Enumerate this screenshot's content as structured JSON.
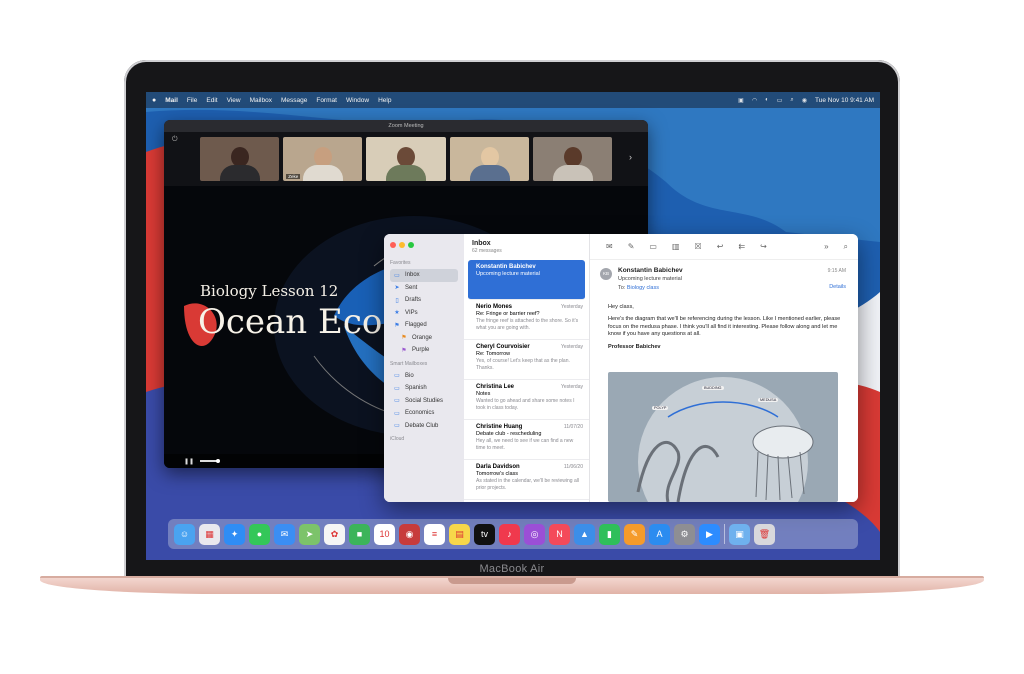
{
  "device": {
    "brand_label": "MacBook Air"
  },
  "menubar": {
    "app": "Mail",
    "items": [
      "File",
      "Edit",
      "View",
      "Mailbox",
      "Message",
      "Format",
      "Window",
      "Help"
    ],
    "clock": "Tue Nov 10  9:41 AM"
  },
  "zoom": {
    "window_title": "Zoom Meeting",
    "participant_tag": "Zeke",
    "slide_subtitle": "Biology Lesson 12",
    "slide_title": "Ocean Eco"
  },
  "mail": {
    "sidebar": {
      "favorites_header": "Favorites",
      "smart_header": "Smart Mailboxes",
      "icloud_header": "iCloud",
      "favorites": [
        {
          "label": "Inbox",
          "icon": "inbox-icon"
        },
        {
          "label": "Sent",
          "icon": "sent-icon"
        },
        {
          "label": "Drafts",
          "icon": "drafts-icon"
        },
        {
          "label": "VIPs",
          "icon": "star-icon"
        },
        {
          "label": "Flagged",
          "icon": "flag-icon"
        }
      ],
      "flag_subs": [
        "Orange",
        "Purple"
      ],
      "folders": [
        "Bio",
        "Spanish",
        "Social Studies",
        "Economics",
        "Debate Club"
      ]
    },
    "list": {
      "title": "Inbox",
      "count": "62 messages",
      "messages": [
        {
          "from": "Konstantin Babichev",
          "date": "",
          "subject": "Upcoming lecture material",
          "preview": ""
        },
        {
          "from": "Nerio Mones",
          "date": "Yesterday",
          "subject": "Re: Fringe or barrier reef?",
          "preview": "The fringe reef is attached to the shore. So it's what you are going with."
        },
        {
          "from": "Cheryl Courvoisier",
          "date": "Yesterday",
          "subject": "Re: Tomorrow",
          "preview": "Yes, of course! Let's keep that as the plan. Thanks."
        },
        {
          "from": "Christina Lee",
          "date": "Yesterday",
          "subject": "Notes",
          "preview": "Wanted to go ahead and share some notes I took in class today."
        },
        {
          "from": "Christine Huang",
          "date": "11/07/20",
          "subject": "Debate club - rescheduling",
          "preview": "Hey all, we need to see if we can find a new time to meet."
        },
        {
          "from": "Darla Davidson",
          "date": "11/06/20",
          "subject": "Tomorrow's class",
          "preview": "As stated in the calendar, we'll be reviewing all prior projects."
        }
      ]
    },
    "reader": {
      "avatar_initials": "KB",
      "from": "Konstantin Babichev",
      "subject": "Upcoming lecture material",
      "to_label": "To:",
      "to": "Biology class",
      "time": "9:15 AM",
      "details_label": "Details",
      "greeting": "Hey class,",
      "body": "Here's the diagram that we'll be referencing during the lesson. Like I mentioned earlier, please focus on the medusa phase. I think you'll all find it interesting. Please follow along and let me know if you have any questions at all.",
      "signature": "Professor Babichev",
      "diagram_labels": [
        "BUDDING",
        "POLYP",
        "MEDUSA"
      ]
    }
  },
  "dock": {
    "apps": [
      {
        "name": "finder",
        "color": "#4aa3f0",
        "glyph": "☺"
      },
      {
        "name": "launchpad",
        "color": "#e9e9ee",
        "glyph": "▦"
      },
      {
        "name": "safari",
        "color": "#2f8df5",
        "glyph": "✦"
      },
      {
        "name": "messages",
        "color": "#34c759",
        "glyph": "●"
      },
      {
        "name": "mail",
        "color": "#3b8ef3",
        "glyph": "✉"
      },
      {
        "name": "maps",
        "color": "#7cc36a",
        "glyph": "➤"
      },
      {
        "name": "photos",
        "color": "#f5f5f5",
        "glyph": "✿"
      },
      {
        "name": "facetime",
        "color": "#3cb45a",
        "glyph": "■"
      },
      {
        "name": "calendar",
        "color": "#ffffff",
        "glyph": "10"
      },
      {
        "name": "photo-booth",
        "color": "#c73b3b",
        "glyph": "◉"
      },
      {
        "name": "reminders",
        "color": "#ffffff",
        "glyph": "≡"
      },
      {
        "name": "notes",
        "color": "#f7d74a",
        "glyph": "▤"
      },
      {
        "name": "apple-tv",
        "color": "#111111",
        "glyph": "tv"
      },
      {
        "name": "music",
        "color": "#f0394d",
        "glyph": "♪"
      },
      {
        "name": "podcasts",
        "color": "#9b4fd6",
        "glyph": "◎"
      },
      {
        "name": "news",
        "color": "#f44a5a",
        "glyph": "N"
      },
      {
        "name": "keynote",
        "color": "#3c8ee8",
        "glyph": "▲"
      },
      {
        "name": "numbers",
        "color": "#2fbf5a",
        "glyph": "▮"
      },
      {
        "name": "pages",
        "color": "#f59b2b",
        "glyph": "✎"
      },
      {
        "name": "app-store",
        "color": "#2b8cf0",
        "glyph": "A"
      },
      {
        "name": "system-preferences",
        "color": "#8e8e93",
        "glyph": "⚙"
      },
      {
        "name": "zoom",
        "color": "#2d8cff",
        "glyph": "▶"
      }
    ],
    "right": [
      {
        "name": "downloads-folder",
        "color": "#6fb1ee",
        "glyph": "▣"
      },
      {
        "name": "trash",
        "color": "#d8d8dc",
        "glyph": "🗑"
      }
    ]
  },
  "colors": {
    "wallpaper_blue": "#2f78c1",
    "wallpaper_red": "#d93a35",
    "mail_accent": "#2f6fd6",
    "body_rose_gold": "#e8c0b5"
  }
}
